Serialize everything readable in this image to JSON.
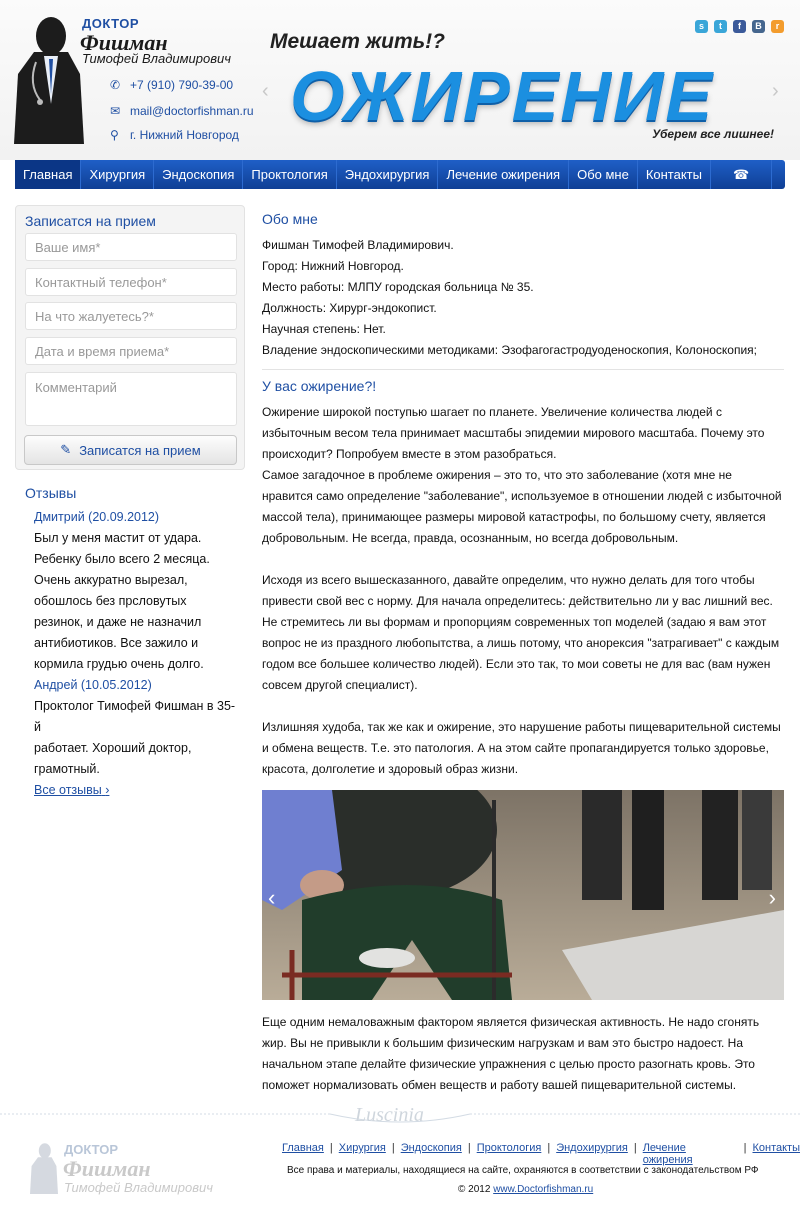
{
  "header": {
    "brand_doctor": "ДОКТОР",
    "brand_name": "Фишман",
    "brand_sub": "Тимофей Владимирович",
    "phone": "+7 (910) 790-39-00",
    "email": "mail@doctorfishman.ru",
    "city": "г. Нижний Новгород",
    "slogan": "Мешает жить!?",
    "big_word": "ОЖИРЕНИЕ",
    "tagline": "Уберем все лишнее!",
    "social_icons": [
      "skype-icon",
      "twitter-icon",
      "facebook-icon",
      "vk-icon",
      "rss-icon"
    ],
    "social_colors": [
      "#3aa6d8",
      "#3aa6d8",
      "#3b5a9a",
      "#45668e",
      "#f39c2d"
    ]
  },
  "nav": {
    "items": [
      "Главная",
      "Хирургия",
      "Эндоскопия",
      "Проктология",
      "Эндохирургия",
      "Лечение ожирения",
      "Обо мне",
      "Контакты"
    ],
    "active_index": 0
  },
  "form": {
    "title": "Записатся на прием",
    "name_placeholder": "Ваше имя*",
    "phone_placeholder": "Контактный телефон*",
    "complaint_placeholder": "На что жалуетесь?*",
    "datetime_placeholder": "Дата и время приема*",
    "comment_placeholder": "Комментарий",
    "submit_label": "Записатся на прием"
  },
  "reviews": {
    "title": "Отзывы",
    "items": [
      {
        "author": "Дмитрий (20.09.2012)",
        "lines": [
          "Был у меня мастит от удара.",
          "Ребенку было всего 2 месяца.",
          "Очень аккуратно вырезал,",
          "обошлось без прсловутых",
          "резинок, и даже не назначил",
          "антибиотиков. Все зажило и",
          "кормила грудью очень долго."
        ]
      },
      {
        "author": "Андрей (10.05.2012)",
        "lines": [
          "Проктолог Тимофей Фишман в 35-й",
          "работает. Хороший доктор,",
          "грамотный."
        ]
      }
    ],
    "all_link": "Все отзывы"
  },
  "main": {
    "about_title": "Обо мне",
    "about_lines": [
      "Фишман Тимофей Владимирович.",
      "Город: Нижний Новгород.",
      "Место работы: МЛПУ городская больница № 35.",
      "Должность: Хирург-эндокопист.",
      "Научная степень: Нет.",
      "Владение эндоскопическими методиками: Эзофагогастродуоденоскопия, Колоноскопия;"
    ],
    "obesity_title": "У вас ожирение?!",
    "paragraphs": [
      [
        "Ожирение широкой поступью шагает по планете. Увеличение количества людей с",
        "избыточным весом тела принимает масштабы эпидемии мирового масштаба. Почему это",
        "происходит? Попробуем вместе в этом разобраться.",
        "Самое загадочное в проблеме ожирения – это то, что это заболевание (хотя мне не",
        "нравится само определение \"заболевание\", используемое в отношении людей с избыточной",
        "массой тела), принимающее размеры мировой катастрофы, по большому счету, является",
        "добровольным. Не всегда, правда, осознанным, но всегда добровольным."
      ],
      [
        "Исходя из всего вышесказанного, давайте определим, что нужно делать для того чтобы",
        "привести свой вес с норму. Для начала определитесь: действительно ли у вас лишний вес.",
        "Не стремитесь ли вы формам и пропорциям современных топ моделей (задаю я вам этот",
        "вопрос не из праздного любопытства, а лишь потому, что анорексия \"затрагивает\" с каждым",
        "годом все большее количество людей). Если это так, то мои советы не для вас (вам нужен",
        "совсем другой специалист)."
      ],
      [
        "Излишняя худоба, так же как и ожирение, это нарушение работы пищеварительной системы",
        "и обмена веществ. Т.е. это патология. А на этом сайте пропагандируется только здоровье,",
        "красота, долголетие и здоровый образ жизни."
      ]
    ],
    "after_photo": [
      "Еще одним немаловажным фактором является физическая активность. Не надо сгонять",
      "жир. Вы не привыкли к большим физическим нагрузкам и вам это быстро надоест. На",
      "начальном этапе делайте физические упражнения с целью просто разогнать кровь. Это",
      "поможет нормализовать обмен веществ и работу вашей пищеварительной системы."
    ]
  },
  "footer": {
    "watermark": "Luscinia",
    "brand_doctor": "ДОКТОР",
    "brand_name": "Фишман",
    "brand_sub": "Тимофей Владимирович",
    "links": [
      "Главная",
      "Хирургия",
      "Эндоскопия",
      "Проктология",
      "Эндохирургия",
      "Лечение ожирения",
      "Контакты"
    ],
    "rights": "Все права и материалы, находящиеся на сайте, охраняются в соответствии с законодательством РФ",
    "copyright_prefix": "© 2012",
    "copyright_link": "www.Doctorfishman.ru"
  }
}
